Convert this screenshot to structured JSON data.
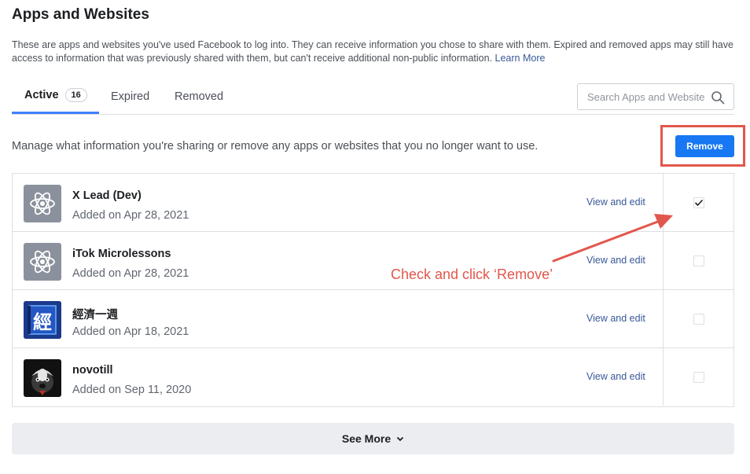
{
  "page": {
    "title": "Apps and Websites",
    "intro": "These are apps and websites you've used Facebook to log into. They can receive information you chose to share with them. Expired and removed apps may still have access to information that was previously shared with them, but can't receive additional non-public information.",
    "learn_more": "Learn More"
  },
  "tabs": [
    {
      "label": "Active",
      "count": "16",
      "active": true
    },
    {
      "label": "Expired",
      "active": false
    },
    {
      "label": "Removed",
      "active": false
    }
  ],
  "search": {
    "placeholder": "Search Apps and Websites",
    "icon": "search-icon"
  },
  "manage": {
    "text": "Manage what information you're sharing or remove any apps or websites that you no longer want to use.",
    "remove_label": "Remove"
  },
  "apps": [
    {
      "name": "X Lead (Dev)",
      "added": "Added on Apr 28, 2021",
      "action": "View and edit",
      "checked": true,
      "icon": "atom-icon"
    },
    {
      "name": "iTok Microlessons",
      "added": "Added on Apr 28, 2021",
      "action": "View and edit",
      "checked": false,
      "icon": "atom-icon"
    },
    {
      "name": "經濟一週",
      "added": "Added on Apr 18, 2021",
      "action": "View and edit",
      "checked": false,
      "icon": "book-icon",
      "icon_glyph": "經"
    },
    {
      "name": "novotill",
      "added": "Added on Sep 11, 2020",
      "action": "View and edit",
      "checked": false,
      "icon": "badger-icon"
    }
  ],
  "annotation": {
    "text": "Check and click ‘Remove’",
    "color": "#e2574c"
  },
  "see_more": {
    "label": "See More",
    "icon": "chevron-down-icon"
  },
  "colors": {
    "accent": "#1877f2",
    "tab_underline": "#4080ff",
    "link": "#385898",
    "annotation": "#e2574c"
  }
}
